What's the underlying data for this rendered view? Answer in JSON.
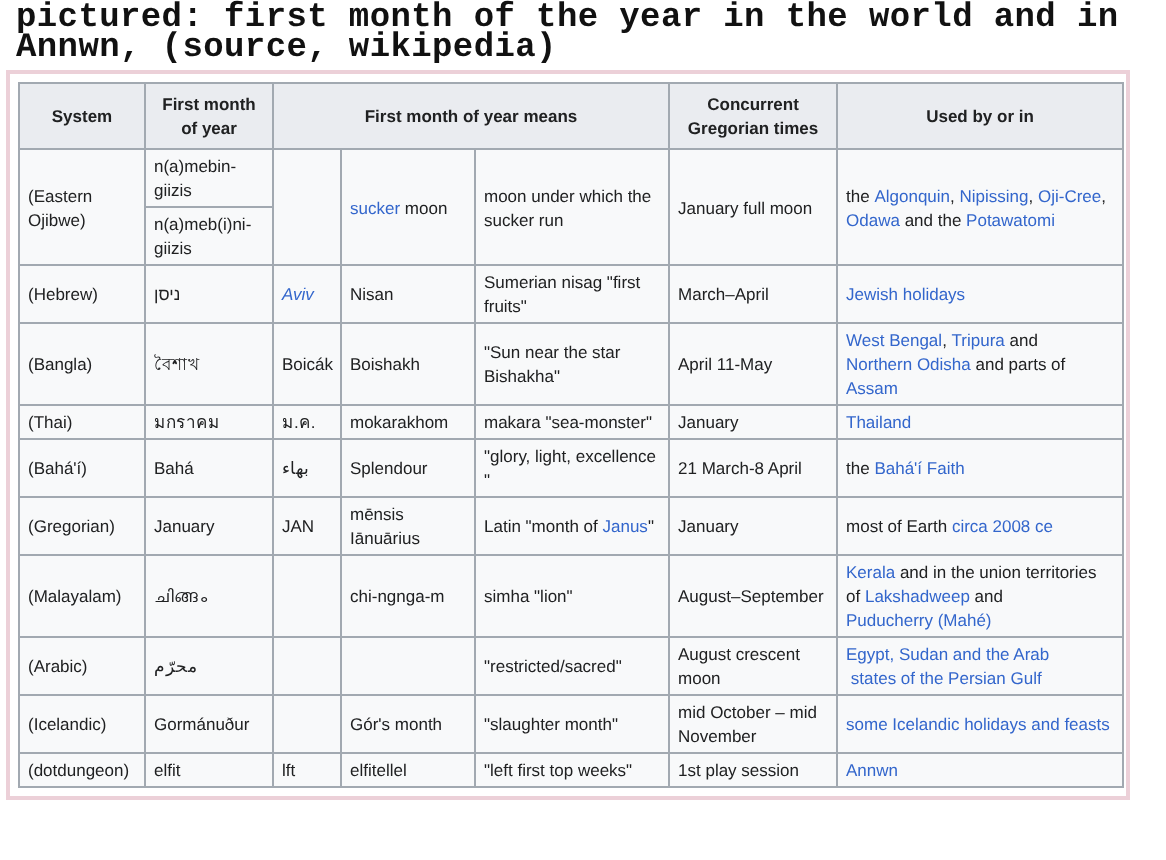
{
  "caption": [
    "pictured: first month of the year in the world and in",
    "Annwn, (source, wikipedia)"
  ],
  "table": {
    "columns": [
      {
        "label": "System",
        "kind": "single"
      },
      {
        "label": "First month of year",
        "kind": "single"
      },
      {
        "label": "First month of year means",
        "kind": "group"
      },
      {
        "label": "Concurrent Gregorian times",
        "kind": "single"
      },
      {
        "label": "Used by or in",
        "kind": "single"
      }
    ],
    "rows": [
      {
        "system": "(Eastern Ojibwe)",
        "first_month": [
          "n(a)mebin-giizis",
          "n(a)meb(i)ni-giizis"
        ],
        "name": [
          {
            "text": "sucker",
            "kind": "link"
          },
          {
            "text": " moon",
            "kind": "text"
          }
        ],
        "meaning": "moon under which the sucker run",
        "gregorian": "January full moon",
        "used_by": [
          {
            "text": "the ",
            "kind": "text"
          },
          {
            "text": "Algonquin",
            "kind": "link"
          },
          {
            "text": ", ",
            "kind": "text"
          },
          {
            "text": "Nipissing",
            "kind": "link"
          },
          {
            "text": ", ",
            "kind": "text"
          },
          {
            "text": "Oji-Cree",
            "kind": "link"
          },
          {
            "text": ", ",
            "kind": "text"
          },
          {
            "text": "Odawa",
            "kind": "link"
          },
          {
            "text": " and the ",
            "kind": "text"
          },
          {
            "text": "Potawatomi",
            "kind": "link"
          }
        ]
      },
      {
        "system": "(Hebrew)",
        "first_month": [
          "ניסן"
        ],
        "abbreviation": [
          {
            "text": "Aviv",
            "kind": "italic-link"
          }
        ],
        "name": "Nisan",
        "meaning": "Sumerian nisag \"first fruits\"",
        "gregorian": "March–April",
        "used_by": [
          {
            "text": "Jewish holidays",
            "kind": "link"
          }
        ]
      },
      {
        "system": "(Bangla)",
        "first_month": [
          "বৈশাখ"
        ],
        "abbreviation": "Boicák",
        "name": "Boishakh",
        "meaning": "\"Sun near the star Bishakha\"",
        "gregorian": "April 11-May",
        "used_by": [
          {
            "text": "West Bengal",
            "kind": "link"
          },
          {
            "text": ", ",
            "kind": "text"
          },
          {
            "text": "Tripura",
            "kind": "link"
          },
          {
            "text": " and ",
            "kind": "text"
          },
          {
            "text": "Northern Odisha",
            "kind": "link"
          },
          {
            "text": " and parts of ",
            "kind": "text"
          },
          {
            "text": "Assam",
            "kind": "link"
          }
        ]
      },
      {
        "system": "(Thai)",
        "first_month": [
          "มกราคม"
        ],
        "abbreviation": "ม.ค.",
        "name": "mokarakhom",
        "meaning": "makara \"sea-monster\"",
        "gregorian": "January",
        "used_by": [
          {
            "text": "Thailand",
            "kind": "link"
          }
        ]
      },
      {
        "system": "(Bahá'í)",
        "first_month": [
          "Bahá"
        ],
        "abbreviation": "بهاء",
        "name": "Splendour",
        "meaning": "\"glory, light, excellence \"",
        "gregorian": "21 March-8 April",
        "used_by": [
          {
            "text": "the ",
            "kind": "text"
          },
          {
            "text": "Bahá'í Faith",
            "kind": "link"
          }
        ]
      },
      {
        "system": "(Gregorian)",
        "first_month": [
          "January"
        ],
        "abbreviation": "JAN",
        "name": "mēnsis Iānuārius",
        "meaning": [
          {
            "text": "Latin \"month of ",
            "kind": "text"
          },
          {
            "text": "Janus",
            "kind": "link"
          },
          {
            "text": "\"",
            "kind": "text"
          }
        ],
        "gregorian": "January",
        "used_by": [
          {
            "text": "most of Earth ",
            "kind": "text"
          },
          {
            "text": "circa 2008 ce",
            "kind": "link"
          }
        ]
      },
      {
        "system": "(Malayalam)",
        "first_month": [
          "ചിങ്ങം"
        ],
        "name": "chi-ngnga-m",
        "meaning": "simha \"lion\"",
        "gregorian": "August–September",
        "used_by": [
          {
            "text": "Kerala",
            "kind": "link"
          },
          {
            "text": " and in the union territories of ",
            "kind": "text"
          },
          {
            "text": "Lakshadweep",
            "kind": "link"
          },
          {
            "text": " and ",
            "kind": "text"
          },
          {
            "text": "Puducherry (Mahé)",
            "kind": "link"
          }
        ]
      },
      {
        "system": "(Arabic)",
        "first_month": [
          "محرّم"
        ],
        "meaning": "\"restricted/sacred\"",
        "gregorian": "August crescent moon",
        "used_by": [
          {
            "text": "Egypt, Sudan and the Arab",
            "kind": "link"
          },
          {
            "text": "states of the Persian Gulf",
            "kind": "link"
          }
        ]
      },
      {
        "system": "(Icelandic)",
        "first_month": [
          "Gormánuður"
        ],
        "name": "Gór's month",
        "meaning": "\"slaughter month\"",
        "gregorian": "mid October – mid November",
        "used_by": [
          {
            "text": "some Icelandic holidays and",
            "kind": "link"
          },
          {
            "text": "feasts",
            "kind": "link"
          }
        ]
      },
      {
        "system": "(dotdungeon)",
        "first_month": [
          "elfit"
        ],
        "abbreviation": "lft",
        "name": "elfitellel",
        "meaning": "\"left first top weeks\"",
        "gregorian": "1st play session",
        "used_by": [
          {
            "text": "Annwn",
            "kind": "link"
          }
        ]
      }
    ]
  }
}
